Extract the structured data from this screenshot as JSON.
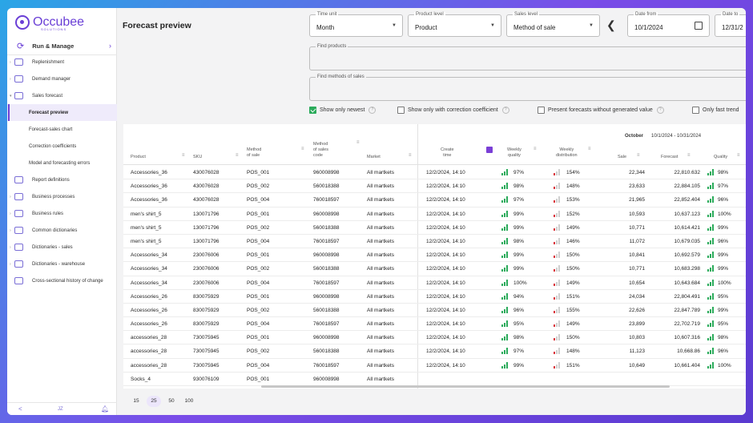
{
  "app": {
    "name": "Occubee",
    "sub": "SOLUTIONS"
  },
  "sidebar": {
    "run_manage": "Run & Manage",
    "items": [
      {
        "label": "Replenishment",
        "caret": ">"
      },
      {
        "label": "Demand manager",
        "caret": ">"
      },
      {
        "label": "Sales forecast",
        "caret": "v"
      },
      {
        "label": "Forecast preview",
        "sub": true,
        "active": true
      },
      {
        "label": "Forecast-sales chart",
        "sub": true
      },
      {
        "label": "Correction coefficients",
        "sub": true
      },
      {
        "label": "Model and forecasting errors",
        "sub": true
      },
      {
        "label": "Report definitions",
        "caret": ""
      },
      {
        "label": "Business processes",
        "caret": ">"
      },
      {
        "label": "Business rules",
        "caret": ">"
      },
      {
        "label": "Common dictionaries",
        "caret": ">"
      },
      {
        "label": "Dictionaries - sales",
        "caret": ">"
      },
      {
        "label": "Dictionaries - warehouse",
        "caret": ">"
      },
      {
        "label": "Cross-sectional history of change",
        "caret": ""
      }
    ],
    "footer": {
      "left": "<",
      "mid": "JZ",
      "right": "bell"
    }
  },
  "main": {
    "title": "Forecast preview",
    "filters": {
      "time_unit": {
        "label": "Time unit",
        "value": "Month"
      },
      "product_level": {
        "label": "Product level",
        "value": "Product"
      },
      "sales_level": {
        "label": "Sales level",
        "value": "Method of sale"
      },
      "date_from": {
        "label": "Date from",
        "value": "10/1/2024"
      },
      "date_to": {
        "label": "Date to",
        "value": "12/31/2"
      }
    },
    "find_products": "Find products",
    "find_methods": "Find methods of sales",
    "checkboxes": [
      {
        "label": "Show only newest",
        "checked": true
      },
      {
        "label": "Show only with correction coefficient",
        "checked": false
      },
      {
        "label": "Present forecasts without generated value",
        "checked": false
      },
      {
        "label": "Only fast trend",
        "checked": false
      }
    ]
  },
  "table": {
    "group_label": "October",
    "group_range": "10/1/2024 - 10/31/2024",
    "columns": {
      "product": "Product",
      "sku": "SKU",
      "method": "Method\nof sale",
      "method_code": "Method\nof sales\ncode",
      "market": "Market",
      "create_time": "Create\ntime",
      "weekly_quality": "Weekly\nquality",
      "weekly_distribution": "Weekly\ndistribution",
      "sale": "Sale",
      "forecast": "Forecast",
      "quality": "Quality"
    },
    "rows": [
      [
        "Accessories_36",
        "430076028",
        "POS_001",
        "960008998",
        "All martkets",
        "12/2/2024, 14:10",
        "97%",
        "154%",
        "22,344",
        "22,810.632",
        "98%"
      ],
      [
        "Accessories_36",
        "430076028",
        "POS_002",
        "560018388",
        "All martkets",
        "12/2/2024, 14:10",
        "98%",
        "148%",
        "23,633",
        "22,884.105",
        "97%"
      ],
      [
        "Accessories_36",
        "430076028",
        "POS_004",
        "760018597",
        "All martkets",
        "12/2/2024, 14:10",
        "97%",
        "153%",
        "21,965",
        "22,852.404",
        "96%"
      ],
      [
        "men's shirt_5",
        "130071796",
        "POS_001",
        "960008998",
        "All martkets",
        "12/2/2024, 14:10",
        "99%",
        "152%",
        "10,593",
        "10,637.123",
        "100%"
      ],
      [
        "men's shirt_5",
        "130071796",
        "POS_002",
        "560018388",
        "All martkets",
        "12/2/2024, 14:10",
        "99%",
        "149%",
        "10,771",
        "10,614.421",
        "99%"
      ],
      [
        "men's shirt_5",
        "130071796",
        "POS_004",
        "760018597",
        "All martkets",
        "12/2/2024, 14:10",
        "98%",
        "146%",
        "11,072",
        "10,679.035",
        "96%"
      ],
      [
        "Accessories_34",
        "230076006",
        "POS_001",
        "960008998",
        "All martkets",
        "12/2/2024, 14:10",
        "99%",
        "150%",
        "10,841",
        "10,692.579",
        "99%"
      ],
      [
        "Accessories_34",
        "230076006",
        "POS_002",
        "560018388",
        "All martkets",
        "12/2/2024, 14:10",
        "99%",
        "150%",
        "10,771",
        "10,683.298",
        "99%"
      ],
      [
        "Accessories_34",
        "230076006",
        "POS_004",
        "760018597",
        "All martkets",
        "12/2/2024, 14:10",
        "100%",
        "149%",
        "10,654",
        "10,643.684",
        "100%"
      ],
      [
        "Accessories_26",
        "830075929",
        "POS_001",
        "960008998",
        "All martkets",
        "12/2/2024, 14:10",
        "94%",
        "151%",
        "24,034",
        "22,804.491",
        "95%"
      ],
      [
        "Accessories_26",
        "830075929",
        "POS_002",
        "560018388",
        "All martkets",
        "12/2/2024, 14:10",
        "96%",
        "155%",
        "22,626",
        "22,847.789",
        "99%"
      ],
      [
        "Accessories_26",
        "830075929",
        "POS_004",
        "760018597",
        "All martkets",
        "12/2/2024, 14:10",
        "95%",
        "149%",
        "23,899",
        "22,702.719",
        "95%"
      ],
      [
        "accessories_28",
        "730075945",
        "POS_001",
        "960008998",
        "All martkets",
        "12/2/2024, 14:10",
        "98%",
        "150%",
        "10,803",
        "10,607.316",
        "98%"
      ],
      [
        "accessories_28",
        "730075945",
        "POS_002",
        "560018388",
        "All martkets",
        "12/2/2024, 14:10",
        "97%",
        "148%",
        "11,123",
        "10,668.86",
        "96%"
      ],
      [
        "accessories_28",
        "730075945",
        "POS_004",
        "760018597",
        "All martkets",
        "12/2/2024, 14:10",
        "99%",
        "151%",
        "10,649",
        "10,661.404",
        "100%"
      ],
      [
        "Socks_4",
        "930076109",
        "POS_001",
        "960008998",
        "All martkets",
        "",
        "",
        "",
        "",
        "",
        ""
      ]
    ]
  },
  "pager": {
    "sizes": [
      "15",
      "25",
      "50",
      "100"
    ],
    "selected": "25"
  },
  "colors": {
    "accent": "#6a3fd6",
    "good": "#2bab5b",
    "bad": "#d9323a"
  }
}
